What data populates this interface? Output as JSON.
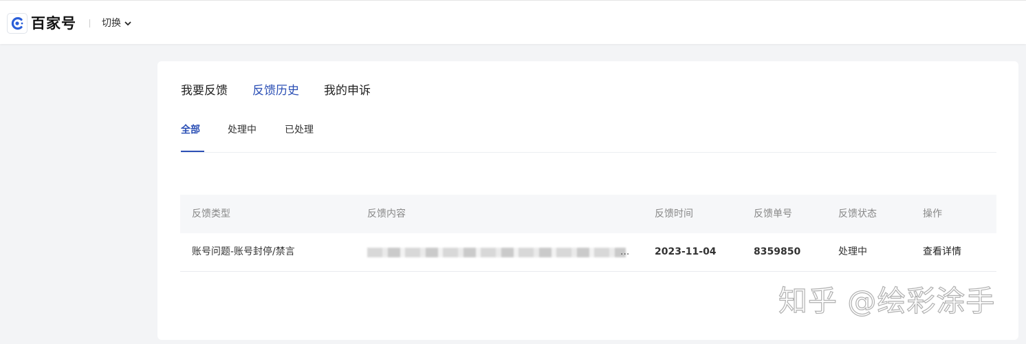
{
  "header": {
    "logo_text": "百家号",
    "switch_label": "切换"
  },
  "tabs": {
    "main": [
      {
        "label": "我要反馈",
        "active": false
      },
      {
        "label": "反馈历史",
        "active": true
      },
      {
        "label": "我的申诉",
        "active": false
      }
    ],
    "sub": [
      {
        "label": "全部",
        "active": true
      },
      {
        "label": "处理中",
        "active": false
      },
      {
        "label": "已处理",
        "active": false
      }
    ]
  },
  "table": {
    "headers": [
      "反馈类型",
      "反馈内容",
      "反馈时间",
      "反馈单号",
      "反馈状态",
      "操作"
    ],
    "rows": [
      {
        "type": "账号问题-账号封停/禁言",
        "content_suffix": "...",
        "time": "2023-11-04",
        "order_no": "8359850",
        "status": "处理中",
        "action": "查看详情"
      }
    ]
  },
  "watermark": "知乎 @绘彩涂手",
  "colors": {
    "accent": "#2b4fb5",
    "page_bg": "#f3f4f6",
    "table_header_bg": "#f6f7f9"
  },
  "icons": {
    "logo": "baijiahao-logo-icon",
    "switch": "chevron-down-icon"
  }
}
